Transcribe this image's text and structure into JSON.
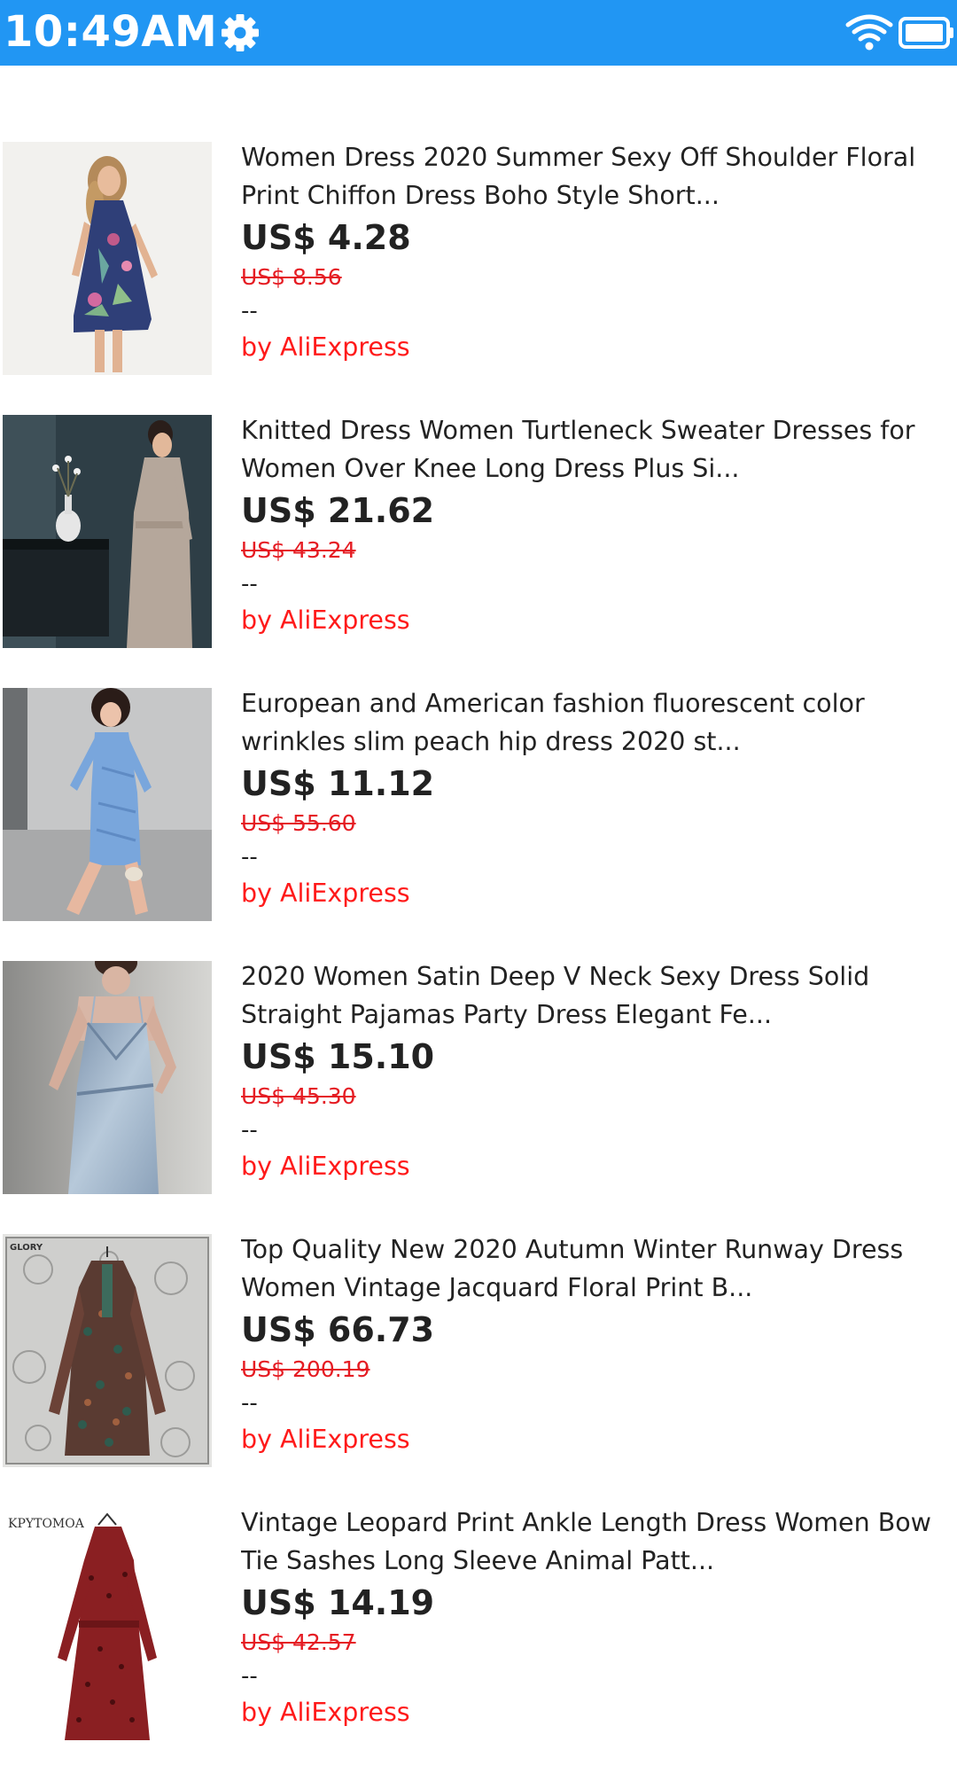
{
  "status_bar": {
    "time": "10:49AM",
    "settings_icon": "gear-icon",
    "wifi_icon": "wifi-icon",
    "battery_icon": "battery-icon",
    "color": "#2196F3"
  },
  "products": [
    {
      "title": "Women Dress 2020 Summer Sexy Off Shoulder Floral Print Chiffon Dress Boho Style Short...",
      "price": "US$ 4.28",
      "original_price": "US$ 8.56",
      "separator": "--",
      "seller": "by AliExpress"
    },
    {
      "title": "Knitted Dress Women Turtleneck Sweater Dresses for Women Over Knee Long Dress Plus Si...",
      "price": "US$ 21.62",
      "original_price": "US$ 43.24",
      "separator": "--",
      "seller": "by AliExpress"
    },
    {
      "title": "European and American fashion fluorescent color wrinkles slim peach hip dress 2020 st...",
      "price": "US$ 11.12",
      "original_price": "US$ 55.60",
      "separator": "--",
      "seller": "by AliExpress"
    },
    {
      "title": "2020 Women Satin Deep V Neck Sexy Dress Solid Straight Pajamas Party Dress Elegant Fe...",
      "price": "US$ 15.10",
      "original_price": "US$ 45.30",
      "separator": "--",
      "seller": "by AliExpress"
    },
    {
      "title": "Top Quality New 2020 Autumn Winter Runway Dress Women Vintage Jacquard Floral Print B...",
      "price": "US$ 66.73",
      "original_price": "US$ 200.19",
      "separator": "--",
      "seller": "by AliExpress"
    },
    {
      "title": "Vintage Leopard Print Ankle Length Dress Women Bow Tie Sashes Long Sleeve Animal Patt...",
      "price": "US$ 14.19",
      "original_price": "US$ 42.57",
      "separator": "--",
      "seller": "by AliExpress"
    }
  ],
  "thumbnail_labels": {
    "item5": "GLORY",
    "item6": "KPYTOMOA"
  }
}
